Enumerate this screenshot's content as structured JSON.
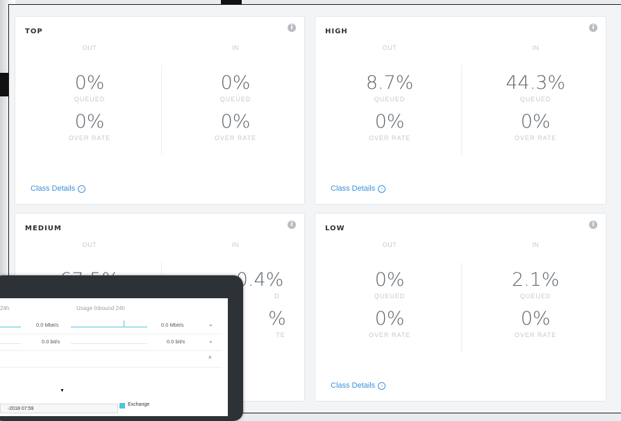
{
  "cards": [
    {
      "title": "TOP",
      "out_label": "OUT",
      "in_label": "IN",
      "out_queued": "0%",
      "in_queued": "0%",
      "out_over": "0%",
      "in_over": "0%",
      "queued_label": "QUEUED",
      "over_label": "OVER RATE",
      "details": "Class Details"
    },
    {
      "title": "HIGH",
      "out_label": "OUT",
      "in_label": "IN",
      "out_queued": "8.7%",
      "in_queued": "44.3%",
      "out_over": "0%",
      "in_over": "0%",
      "queued_label": "QUEUED",
      "over_label": "OVER RATE",
      "details": "Class Details"
    },
    {
      "title": "MEDIUM",
      "out_label": "OUT",
      "in_label": "IN",
      "out_queued": "",
      "in_queued": "",
      "out_over": "",
      "in_over": "",
      "queued_label": "",
      "over_label": "",
      "details": ""
    },
    {
      "title": "LOW",
      "out_label": "OUT",
      "in_label": "IN",
      "out_queued": "0%",
      "in_queued": "2.1%",
      "out_over": "0%",
      "in_over": "0%",
      "queued_label": "QUEUED",
      "over_label": "OVER RATE",
      "details": "Class Details"
    }
  ],
  "medium_visible": {
    "in_queued_fragment": "0.4%",
    "out_queued_fragment": "67.5%",
    "in_queued_label_fragment": "D",
    "in_over_fragment": "%",
    "in_over_label_fragment": "TE"
  },
  "tablet": {
    "header_left": "24h",
    "header_right": "Usage Inbound 24h",
    "row1_left": "0.0 Mbit/s",
    "row1_right": "0.0 Mbit/s",
    "row2_left": "0.0 bit/s",
    "row2_right": "0.0 bit/s",
    "date": "-2018 07:59",
    "legend": "Exchange"
  },
  "icons": {
    "info": "info-icon",
    "details_arrow": "circle-arrow-icon"
  },
  "colors": {
    "link": "#3a8fd8",
    "value": "#5f666d",
    "label": "#c4c8cd",
    "sparkline": "#54c1d8"
  }
}
